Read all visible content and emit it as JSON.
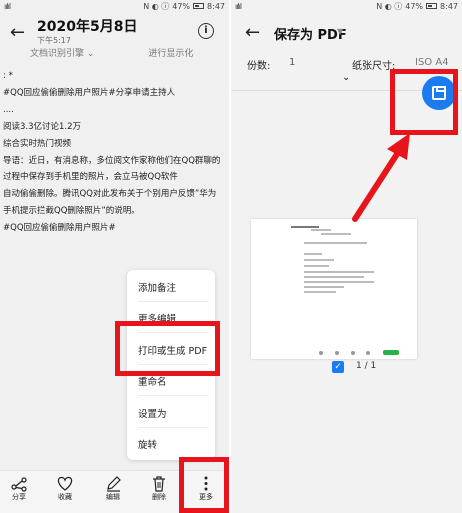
{
  "left": {
    "status": {
      "signal": "ıılıl",
      "icons": "N ◐ ⓘ",
      "battery": "47%",
      "time": "8:47"
    },
    "header": {
      "back_icon": "arrow-left-icon",
      "title": "2020年5月8日",
      "subtitle": "下午5:17",
      "info_icon": "info-icon"
    },
    "toolbar_partial": [
      "文档识别引擎 ⌄",
      "进行显示化"
    ],
    "content_lines": [
      ": *",
      "#QQ回应偷偷删除用户照片#分享申请主持人",
      "....",
      "阅读3.3亿讨论1.2万",
      "综合实时热门视频",
      "导语：近日，有消息称，多位阅文作家称他们在QQ群聊的",
      "过程中保存到手机里的照片，会立马被QQ软件",
      "自动偷偷删除。腾讯QQ对此发布关于个别用户反馈”华为",
      "手机提示拦截QQ删除照片”的说明。",
      "#QQ回应偷偷删除用户照片#"
    ],
    "menu": {
      "items": [
        "添加备注",
        "更多编辑",
        "打印或生成 PDF",
        "重命名",
        "设置为",
        "旋转"
      ]
    },
    "bottom_bar": [
      {
        "label": "分享",
        "icon": "share-icon"
      },
      {
        "label": "收藏",
        "icon": "heart-icon"
      },
      {
        "label": "编辑",
        "icon": "pencil-icon"
      },
      {
        "label": "删除",
        "icon": "trash-icon"
      },
      {
        "label": "更多",
        "icon": "more-vertical-icon"
      }
    ]
  },
  "right": {
    "status": {
      "signal": "ıılıl",
      "icons": "N ◐ ⓘ",
      "battery": "47%",
      "time": "8:47"
    },
    "header": {
      "back_icon": "arrow-left-icon",
      "title": "保存为 PDF",
      "caret": "▼"
    },
    "options": {
      "copies_label": "份数:",
      "copies_value": "1",
      "paper_label": "纸张尺寸:",
      "paper_value": "ISO A4"
    },
    "expand_icon": "chevron-down-icon",
    "save_icon": "save-icon",
    "page_count": "1 / 1"
  },
  "colors": {
    "accent": "#1a7cf0",
    "highlight": "#e8141b"
  }
}
